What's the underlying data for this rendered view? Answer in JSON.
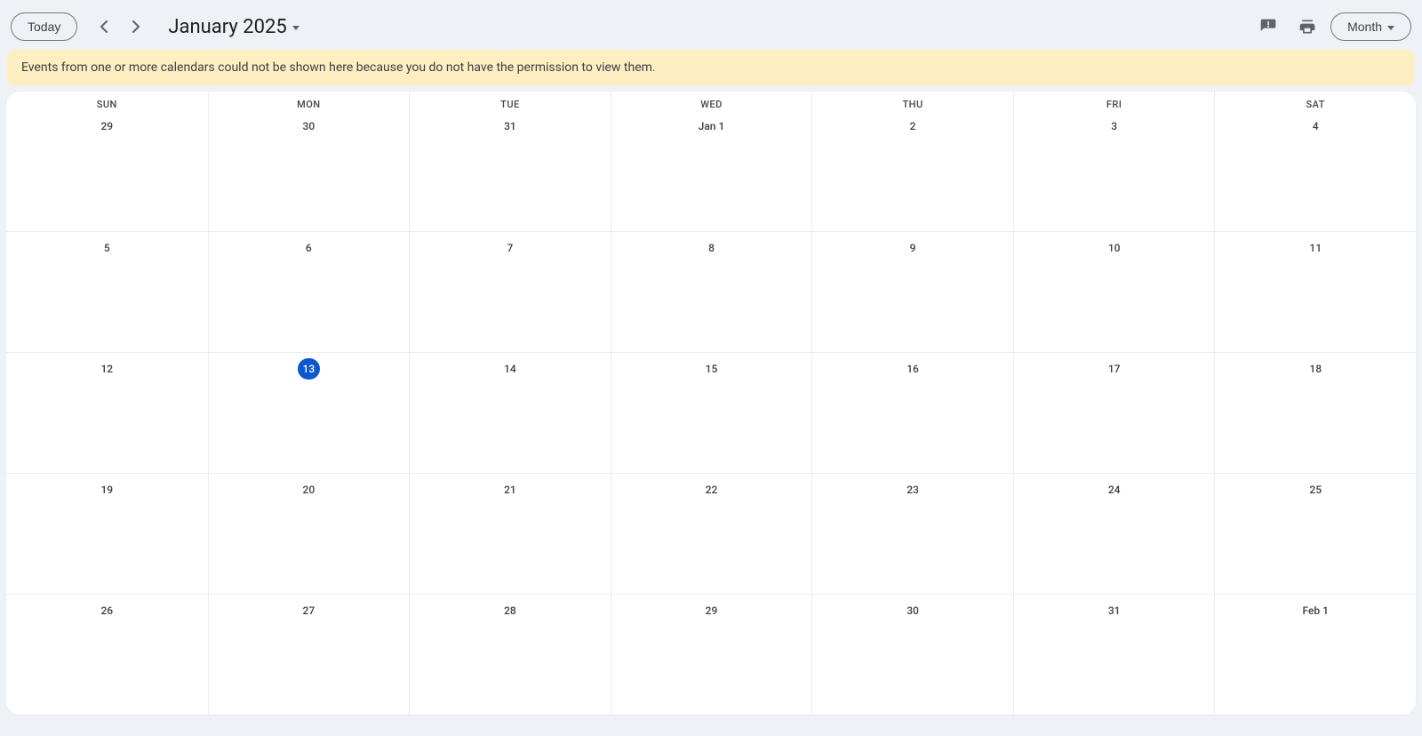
{
  "toolbar": {
    "today_label": "Today",
    "month_title": "January 2025",
    "view_label": "Month"
  },
  "banner": {
    "message": "Events from one or more calendars could not be shown here because you do not have the permission to view them."
  },
  "day_headers": [
    "SUN",
    "MON",
    "TUE",
    "WED",
    "THU",
    "FRI",
    "SAT"
  ],
  "weeks": [
    [
      {
        "label": "29",
        "today": false
      },
      {
        "label": "30",
        "today": false
      },
      {
        "label": "31",
        "today": false
      },
      {
        "label": "Jan 1",
        "today": false
      },
      {
        "label": "2",
        "today": false
      },
      {
        "label": "3",
        "today": false
      },
      {
        "label": "4",
        "today": false
      }
    ],
    [
      {
        "label": "5",
        "today": false
      },
      {
        "label": "6",
        "today": false
      },
      {
        "label": "7",
        "today": false
      },
      {
        "label": "8",
        "today": false
      },
      {
        "label": "9",
        "today": false
      },
      {
        "label": "10",
        "today": false
      },
      {
        "label": "11",
        "today": false
      }
    ],
    [
      {
        "label": "12",
        "today": false
      },
      {
        "label": "13",
        "today": true
      },
      {
        "label": "14",
        "today": false
      },
      {
        "label": "15",
        "today": false
      },
      {
        "label": "16",
        "today": false
      },
      {
        "label": "17",
        "today": false
      },
      {
        "label": "18",
        "today": false
      }
    ],
    [
      {
        "label": "19",
        "today": false
      },
      {
        "label": "20",
        "today": false
      },
      {
        "label": "21",
        "today": false
      },
      {
        "label": "22",
        "today": false
      },
      {
        "label": "23",
        "today": false
      },
      {
        "label": "24",
        "today": false
      },
      {
        "label": "25",
        "today": false
      }
    ],
    [
      {
        "label": "26",
        "today": false
      },
      {
        "label": "27",
        "today": false
      },
      {
        "label": "28",
        "today": false
      },
      {
        "label": "29",
        "today": false
      },
      {
        "label": "30",
        "today": false
      },
      {
        "label": "31",
        "today": false
      },
      {
        "label": "Feb 1",
        "today": false
      }
    ]
  ]
}
